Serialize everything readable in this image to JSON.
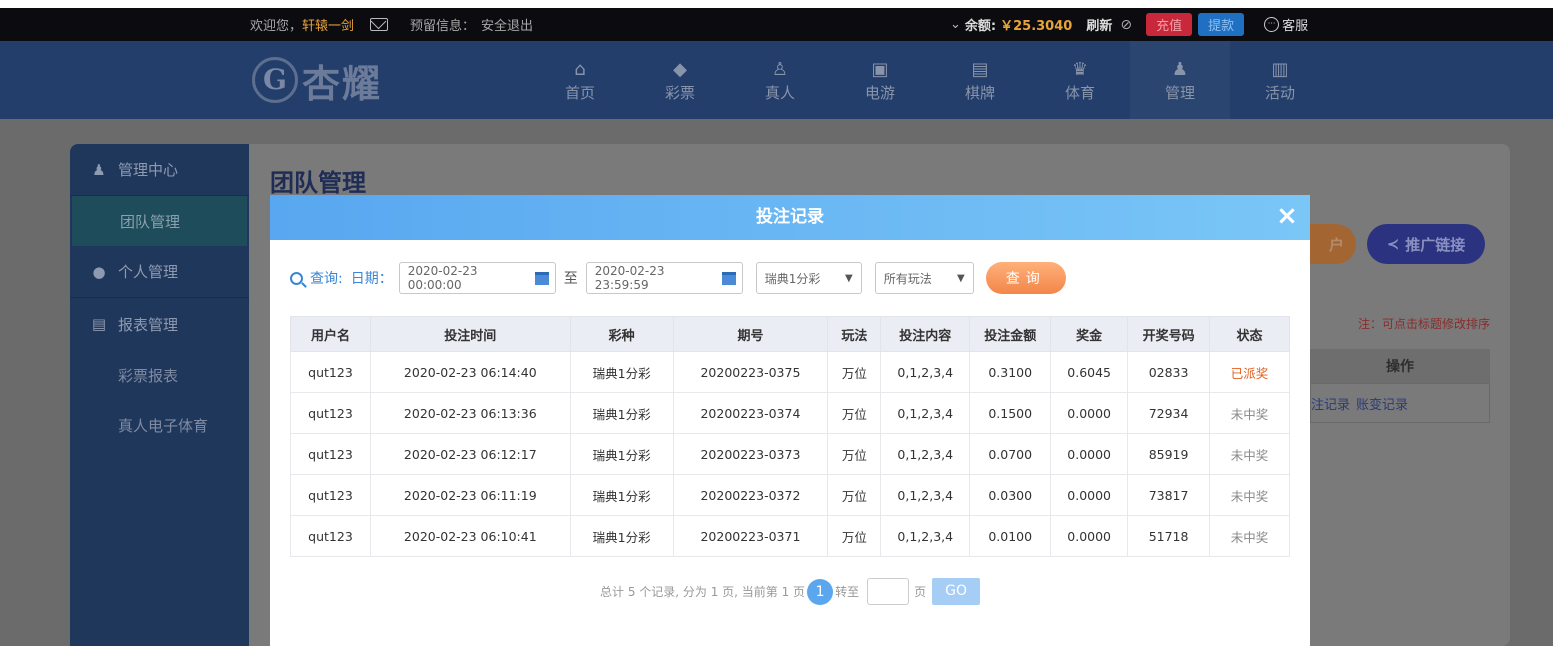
{
  "topbar": {
    "welcome": "欢迎您，",
    "username": "轩辕一剑",
    "reserved_info": "预留信息：",
    "logout": "安全退出",
    "balance_label": "余额:",
    "balance": "￥25.3040",
    "refresh": "刷新",
    "deposit": "充值",
    "withdraw": "提款",
    "customer_service": "客服"
  },
  "header": {
    "logo_text": "杏耀",
    "nav": [
      {
        "label": "首页",
        "icon": "home-icon",
        "glyph": "⌂"
      },
      {
        "label": "彩票",
        "icon": "lottery-icon",
        "glyph": "◆"
      },
      {
        "label": "真人",
        "icon": "live-dealer-icon",
        "glyph": "♙"
      },
      {
        "label": "电游",
        "icon": "slot-machine-icon",
        "glyph": "▣"
      },
      {
        "label": "棋牌",
        "icon": "cards-icon",
        "glyph": "▤"
      },
      {
        "label": "体育",
        "icon": "trophy-icon",
        "glyph": "♛"
      },
      {
        "label": "管理",
        "icon": "users-icon",
        "glyph": "♟"
      },
      {
        "label": "活动",
        "icon": "gift-icon",
        "glyph": "▥"
      }
    ]
  },
  "sidebar": {
    "sections": [
      {
        "label": "管理中心",
        "items": [
          "团队管理"
        ]
      },
      {
        "label": "个人管理",
        "items": []
      },
      {
        "label": "报表管理",
        "items": [
          "彩票报表",
          "真人电子体育"
        ]
      }
    ]
  },
  "page": {
    "title": "团队管理",
    "promo_link": "推广链接",
    "orange_btn_tail": "户",
    "note": "注：可点击标题修改排序",
    "op_header": "操作",
    "op_links": [
      "注记录",
      "账变记录"
    ]
  },
  "modal": {
    "title": "投注记录",
    "close": "×",
    "query_label": "查询:",
    "date_label": "日期：",
    "date_from": "2020-02-23 00:00:00",
    "date_sep": "至",
    "date_to": "2020-02-23 23:59:59",
    "lottery_select": "瑞典1分彩",
    "play_select": "所有玩法",
    "query_button": "查询",
    "columns": [
      "用户名",
      "投注时间",
      "彩种",
      "期号",
      "玩法",
      "投注内容",
      "投注金额",
      "奖金",
      "开奖号码",
      "状态"
    ],
    "rows": [
      [
        "qut123",
        "2020-02-23 06:14:40",
        "瑞典1分彩",
        "20200223-0375",
        "万位",
        "0,1,2,3,4",
        "0.3100",
        "0.6045",
        "02833",
        "已派奖"
      ],
      [
        "qut123",
        "2020-02-23 06:13:36",
        "瑞典1分彩",
        "20200223-0374",
        "万位",
        "0,1,2,3,4",
        "0.1500",
        "0.0000",
        "72934",
        "未中奖"
      ],
      [
        "qut123",
        "2020-02-23 06:12:17",
        "瑞典1分彩",
        "20200223-0373",
        "万位",
        "0,1,2,3,4",
        "0.0700",
        "0.0000",
        "85919",
        "未中奖"
      ],
      [
        "qut123",
        "2020-02-23 06:11:19",
        "瑞典1分彩",
        "20200223-0372",
        "万位",
        "0,1,2,3,4",
        "0.0300",
        "0.0000",
        "73817",
        "未中奖"
      ],
      [
        "qut123",
        "2020-02-23 06:10:41",
        "瑞典1分彩",
        "20200223-0371",
        "万位",
        "0,1,2,3,4",
        "0.0100",
        "0.0000",
        "51718",
        "未中奖"
      ]
    ],
    "pager": {
      "summary": "总计 5 个记录, 分为 1 页, 当前第 1 页",
      "current": "1",
      "goto_label": "转至",
      "page_unit": "页",
      "go": "GO"
    }
  },
  "colors": {
    "accent": "#5aa6ef",
    "win_status": "#e06020",
    "query_button": "#f2864a"
  }
}
